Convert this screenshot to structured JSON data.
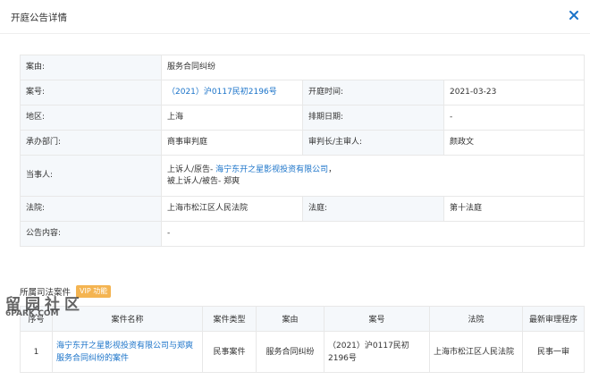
{
  "dialog": {
    "title": "开庭公告详情"
  },
  "info": {
    "cause_label": "案由:",
    "cause_value": "服务合同纠纷",
    "case_no_label": "案号:",
    "case_no_value": "（2021）沪0117民初2196号",
    "hearing_time_label": "开庭时间:",
    "hearing_time_value": "2021-03-23",
    "region_label": "地区:",
    "region_value": "上海",
    "schedule_label": "排期日期:",
    "schedule_value": "-",
    "dept_label": "承办部门:",
    "dept_value": "商事审判庭",
    "judge_label": "审判长/主审人:",
    "judge_value": "颜政文",
    "parties_label": "当事人:",
    "appellant_prefix": "上诉人/原告- ",
    "appellant_name": "海宁东开之星影视投资有限公司",
    "appellant_suffix": "，",
    "appellee_prefix": "被上诉人/被告- ",
    "appellee_name": "郑爽",
    "court_label": "法院:",
    "court_value": "上海市松江区人民法院",
    "courtroom_label": "法庭:",
    "courtroom_value": "第十法庭",
    "content_label": "公告内容:",
    "content_value": "-"
  },
  "related": {
    "title": "所属司法案件",
    "vip_badge": "VIP 功能",
    "headers": [
      "序号",
      "案件名称",
      "案件类型",
      "案由",
      "案号",
      "法院",
      "最新审理程序"
    ],
    "rows": [
      {
        "index": "1",
        "name": "海宁东开之星影视投资有限公司与郑爽服务合同纠纷的案件",
        "type": "民事案件",
        "cause": "服务合同纠纷",
        "case_no": "（2021）沪0117民初2196号",
        "court": "上海市松江区人民法院",
        "procedure": "民事一审"
      }
    ]
  },
  "watermark": {
    "text": "留园社区",
    "sub": "6PARK.COM"
  },
  "colors": {
    "link": "#1a73c9",
    "label_bg": "#f5f8fb",
    "border": "#e8e8e8",
    "vip": "#f4b451",
    "close": "#1a73c9"
  },
  "icons": {
    "close": "close-icon"
  }
}
